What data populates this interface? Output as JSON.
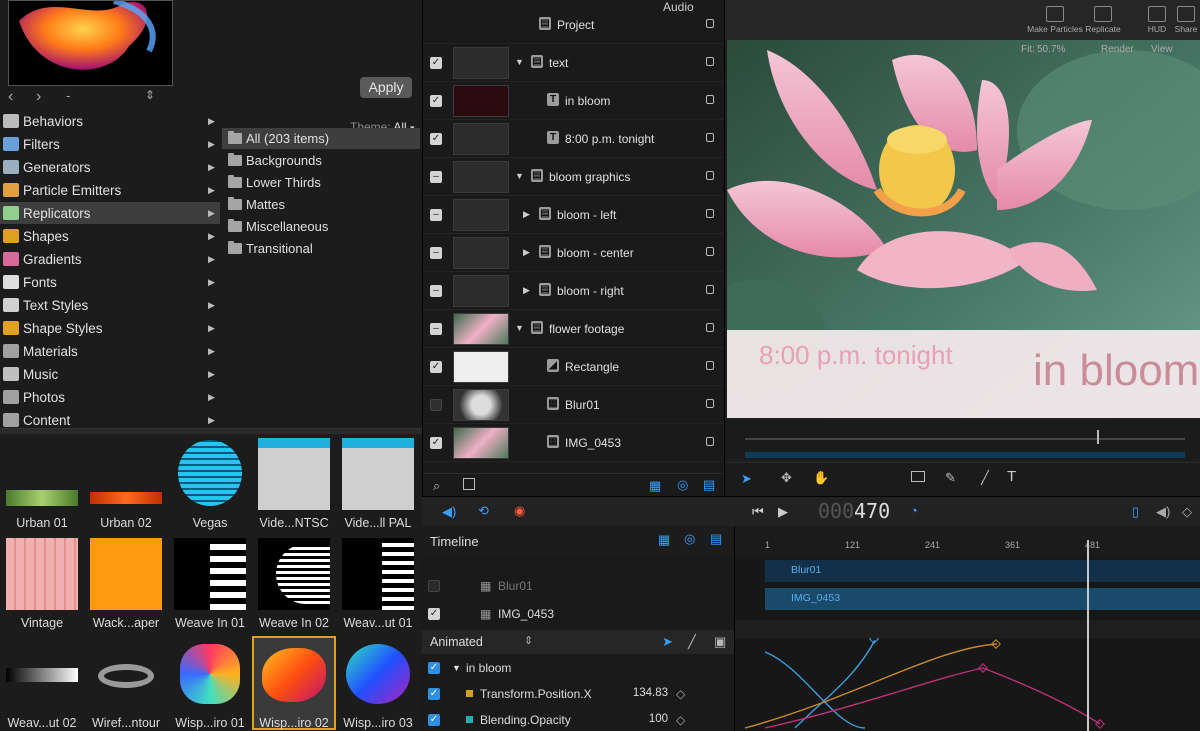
{
  "library": {
    "nav": {
      "back": "‹",
      "forward": "›",
      "path": "-",
      "stepper": "⇕"
    },
    "apply_label": "Apply",
    "theme_label": "Theme:",
    "theme_value": "All",
    "categories": [
      {
        "label": "Behaviors",
        "icon": "gear-icon"
      },
      {
        "label": "Filters",
        "icon": "filter-icon"
      },
      {
        "label": "Generators",
        "icon": "generator-icon"
      },
      {
        "label": "Particle Emitters",
        "icon": "emitter-icon"
      },
      {
        "label": "Replicators",
        "icon": "replicator-icon"
      },
      {
        "label": "Shapes",
        "icon": "shape-icon"
      },
      {
        "label": "Gradients",
        "icon": "gradient-icon"
      },
      {
        "label": "Fonts",
        "icon": "font-icon"
      },
      {
        "label": "Text Styles",
        "icon": "text-style-icon"
      },
      {
        "label": "Shape Styles",
        "icon": "shape-style-icon"
      },
      {
        "label": "Materials",
        "icon": "material-icon"
      },
      {
        "label": "Music",
        "icon": "music-icon"
      },
      {
        "label": "Photos",
        "icon": "photo-icon"
      },
      {
        "label": "Content",
        "icon": "content-icon"
      }
    ],
    "subcategories": [
      "All (203 items)",
      "Backgrounds",
      "Lower Thirds",
      "Mattes",
      "Miscellaneous",
      "Transitional"
    ],
    "tiles": [
      "Urban 01",
      "Urban 02",
      "Vegas",
      "Vide...NTSC",
      "Vide...ll PAL",
      "Vintage",
      "Wack...aper",
      "Weave In 01",
      "Weave In 02",
      "Weav...ut 01",
      "Weav...ut 02",
      "Wiref...ntour",
      "Wisp...iro 01",
      "Wisp...iro 02",
      "Wisp...iro 03"
    ]
  },
  "layers": {
    "header": "Audio",
    "rows": [
      {
        "name": "Project",
        "checked": null
      },
      {
        "name": "text",
        "checked": true
      },
      {
        "name": "in bloom",
        "checked": true
      },
      {
        "name": "8:00 p.m. tonight",
        "checked": true
      },
      {
        "name": "bloom graphics",
        "checked": "mixed"
      },
      {
        "name": "bloom - left",
        "checked": "mixed"
      },
      {
        "name": "bloom - center",
        "checked": "mixed"
      },
      {
        "name": "bloom - right",
        "checked": "mixed"
      },
      {
        "name": "flower footage",
        "checked": "mixed"
      },
      {
        "name": "Rectangle",
        "checked": true
      },
      {
        "name": "Blur01",
        "checked": false
      },
      {
        "name": "IMG_0453",
        "checked": true
      }
    ],
    "thumb_text": "in bloom"
  },
  "canvas": {
    "toolbar": {
      "make_particles": "Make Particles",
      "replicate": "Replicate",
      "hud": "HUD",
      "share": "Share"
    },
    "view": {
      "fit_label": "Fit:",
      "fit_value": "50.7%",
      "render": "Render",
      "view": "View"
    },
    "title_time": "8:00 p.m. tonight",
    "title_main": "in bloom"
  },
  "transport": {
    "timecode_dim": "000",
    "timecode": "470"
  },
  "timeline": {
    "header": "Timeline",
    "rows": [
      {
        "name": "Blur01",
        "checked": false
      },
      {
        "name": "IMG_0453",
        "checked": true
      }
    ],
    "animated_label": "Animated",
    "animated_rows": [
      {
        "name": "in bloom",
        "value": ""
      },
      {
        "name": "Transform.Position.X",
        "value": "134.83"
      },
      {
        "name": "Blending.Opacity",
        "value": "100"
      }
    ],
    "ruler": [
      "1",
      "121",
      "241",
      "361",
      "481"
    ],
    "tracks": [
      "Blur01",
      "IMG_0453"
    ]
  },
  "colors": {
    "accent_blue": "#2f8fe0",
    "selection_gold": "#e0a020",
    "canvas_title_pink": "#c98c98"
  }
}
